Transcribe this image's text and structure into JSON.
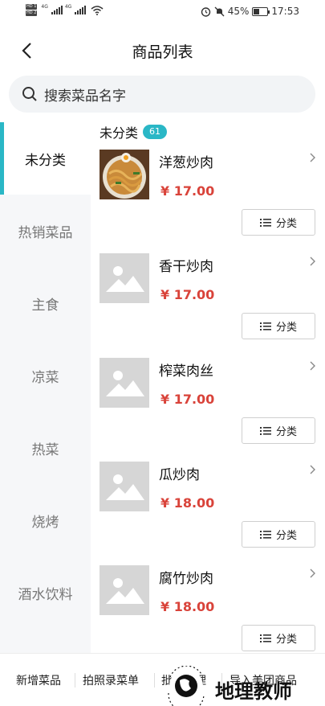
{
  "status_bar": {
    "hd1": "HD 1",
    "hd2": "HD 2",
    "net1": "4G",
    "net2": "4G",
    "battery": "45%",
    "battery_level": 0.45,
    "time": "17:53"
  },
  "header": {
    "title": "商品列表",
    "back_icon": "chevron-left-icon"
  },
  "search": {
    "placeholder": "搜索菜品名字",
    "icon": "search-icon"
  },
  "sidebar": {
    "items": [
      {
        "label": "未分类",
        "active": true
      },
      {
        "label": "热销菜品",
        "active": false
      },
      {
        "label": "主食",
        "active": false
      },
      {
        "label": "凉菜",
        "active": false
      },
      {
        "label": "热菜",
        "active": false
      },
      {
        "label": "烧烤",
        "active": false
      },
      {
        "label": "酒水饮料",
        "active": false
      }
    ]
  },
  "group": {
    "title": "未分类",
    "count": "61"
  },
  "items": [
    {
      "name": "洋葱炒肉",
      "price": "¥ 17.00",
      "category_label": "分类",
      "has_photo": true
    },
    {
      "name": "香干炒肉",
      "price": "¥ 17.00",
      "category_label": "分类",
      "has_photo": false
    },
    {
      "name": "榨菜肉丝",
      "price": "¥ 17.00",
      "category_label": "分类",
      "has_photo": false
    },
    {
      "name": "瓜炒肉",
      "price": "¥ 18.00",
      "category_label": "分类",
      "has_photo": false
    },
    {
      "name": "腐竹炒肉",
      "price": "¥ 18.00",
      "category_label": "分类",
      "has_photo": false
    }
  ],
  "bottom_bar": {
    "add": "新增菜品",
    "photo": "拍照录菜单",
    "manage": "批量管理",
    "import": "导入美团商品"
  },
  "watermark": {
    "text": "地理教师"
  },
  "colors": {
    "accent": "#2ab7c6",
    "price": "#d9433a",
    "sidebar_bg": "#f6f7f9"
  }
}
